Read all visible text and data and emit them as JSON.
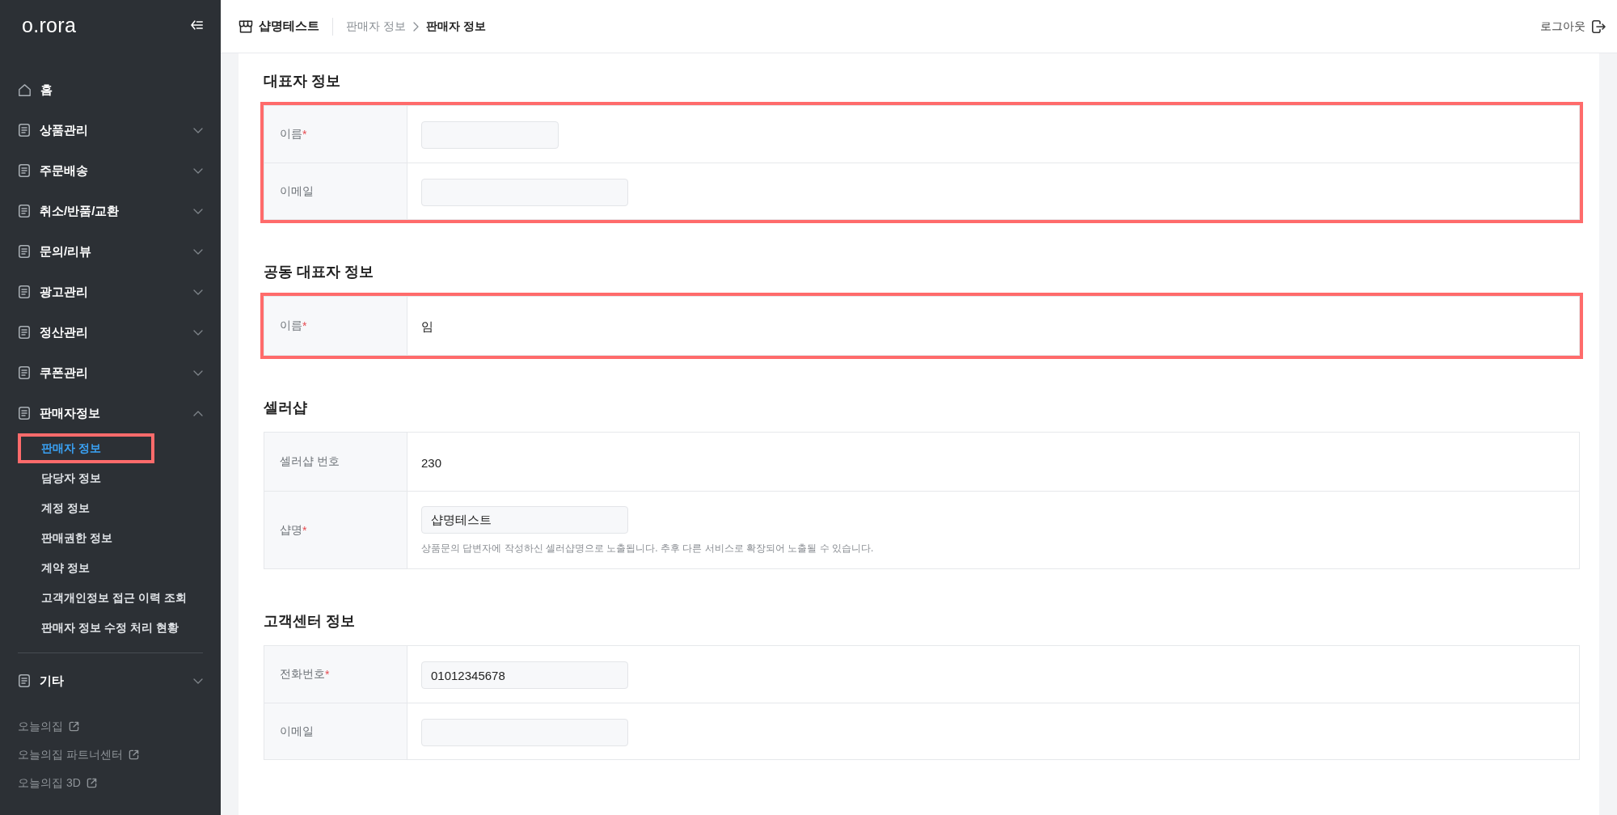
{
  "sidebar": {
    "logo": "o.rora",
    "menu": [
      {
        "kind": "home",
        "label": "홈"
      },
      {
        "kind": "group",
        "label": "상품관리",
        "expanded": false
      },
      {
        "kind": "group",
        "label": "주문배송",
        "expanded": false
      },
      {
        "kind": "group",
        "label": "취소/반품/교환",
        "expanded": false
      },
      {
        "kind": "group",
        "label": "문의/리뷰",
        "expanded": false
      },
      {
        "kind": "group",
        "label": "광고관리",
        "expanded": false
      },
      {
        "kind": "group",
        "label": "정산관리",
        "expanded": false
      },
      {
        "kind": "group",
        "label": "쿠폰관리",
        "expanded": false
      },
      {
        "kind": "group",
        "label": "판매자정보",
        "expanded": true,
        "children": [
          {
            "label": "판매자 정보",
            "selected": true,
            "highlighted": true
          },
          {
            "label": "담당자 정보",
            "selected": false,
            "highlighted": false
          },
          {
            "label": "계정 정보",
            "selected": false,
            "highlighted": false
          },
          {
            "label": "판매권한 정보",
            "selected": false,
            "highlighted": false
          },
          {
            "label": "계약 정보",
            "selected": false,
            "highlighted": false
          },
          {
            "label": "고객개인정보 접근 이력 조회",
            "selected": false,
            "highlighted": false
          },
          {
            "label": "판매자 정보 수정 처리 현황",
            "selected": false,
            "highlighted": false
          }
        ]
      }
    ],
    "more_menu": [
      {
        "kind": "group",
        "label": "기타",
        "expanded": false
      }
    ],
    "links": [
      {
        "label": "오늘의집"
      },
      {
        "label": "오늘의집 파트너센터"
      },
      {
        "label": "오늘의집 3D"
      }
    ]
  },
  "header": {
    "shop_name": "샵명테스트",
    "breadcrumb": [
      "판매자 정보",
      "판매자 정보"
    ],
    "logout": "로그아웃"
  },
  "sections": [
    {
      "title": "대표자 정보",
      "highlighted": true,
      "rows": [
        {
          "label": "이름",
          "required_mark": "*",
          "kind": "short-input"
        },
        {
          "label": "이메일",
          "kind": "input"
        }
      ]
    },
    {
      "title": "공동 대표자 정보",
      "highlighted": true,
      "rows": [
        {
          "label": "이름",
          "required_mark": "*",
          "kind": "text",
          "value": "임"
        }
      ]
    },
    {
      "title": "셀러샵",
      "highlighted": false,
      "rows": [
        {
          "label": "셀러샵 번호",
          "kind": "text",
          "value": "230"
        },
        {
          "label": "샵명",
          "required_mark": "*",
          "kind": "input",
          "value": "샵명테스트",
          "helper": "상품문의 답변자에 작성하신 셀러샵명으로 노출됩니다. 추후 다른 서비스로 확장되어 노출될 수 있습니다."
        }
      ]
    },
    {
      "title": "고객센터 정보",
      "highlighted": false,
      "rows": [
        {
          "label": "전화번호",
          "required_mark": "*",
          "kind": "input",
          "value": "01012345678"
        },
        {
          "label": "이메일",
          "kind": "input"
        }
      ]
    }
  ]
}
